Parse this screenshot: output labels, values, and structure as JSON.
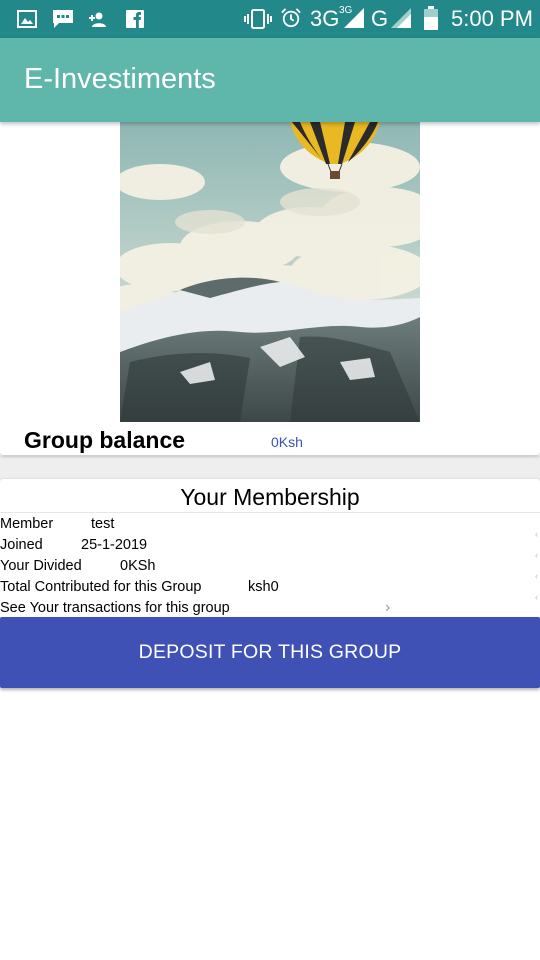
{
  "status_bar": {
    "left_icons": [
      "gallery-icon",
      "chat-icon",
      "add-person-icon",
      "facebook-icon"
    ],
    "right_icons": [
      "vibrate-icon",
      "alarm-icon",
      "signal-3g-icon",
      "signal-g-icon",
      "battery-icon"
    ],
    "network_primary": "3G",
    "network_primary_superscript": "3G",
    "network_secondary": "G",
    "time": "5:00 PM",
    "background_color": "#23888a"
  },
  "app_bar": {
    "title": "E-Investiments",
    "background_color": "#5fb6aa"
  },
  "group": {
    "image": "hot-air-balloon-over-snowy-mountains",
    "balance_label": "Group balance",
    "balance_value": "0Ksh"
  },
  "membership": {
    "title": "Your Membership",
    "rows": [
      {
        "label": "Member",
        "value": "test"
      },
      {
        "label": "Joined",
        "value": "25-1-2019"
      },
      {
        "label": "Your Divided",
        "value": "0KSh"
      },
      {
        "label": "Total Contributed for this Group",
        "value": "ksh0"
      },
      {
        "label": "See Your transactions for this group",
        "icon": "chevron-right-icon"
      }
    ]
  },
  "deposit_button": {
    "label": "DEPOSIT FOR THIS GROUP",
    "background_color": "#3f51b5"
  },
  "colors": {
    "accent": "#3f51b5",
    "page_background": "#eeeeee"
  }
}
